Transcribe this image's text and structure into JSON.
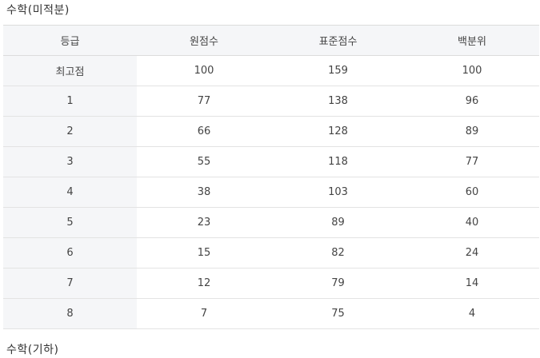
{
  "section_title": "수학(미적분)",
  "next_section_title": "수학(기하)",
  "table": {
    "headers": [
      "등급",
      "원점수",
      "표준점수",
      "백분위"
    ],
    "rows": [
      [
        "최고점",
        "100",
        "159",
        "100"
      ],
      [
        "1",
        "77",
        "138",
        "96"
      ],
      [
        "2",
        "66",
        "128",
        "89"
      ],
      [
        "3",
        "55",
        "118",
        "77"
      ],
      [
        "4",
        "38",
        "103",
        "60"
      ],
      [
        "5",
        "23",
        "89",
        "40"
      ],
      [
        "6",
        "15",
        "82",
        "24"
      ],
      [
        "7",
        "12",
        "79",
        "14"
      ],
      [
        "8",
        "7",
        "75",
        "4"
      ]
    ]
  }
}
